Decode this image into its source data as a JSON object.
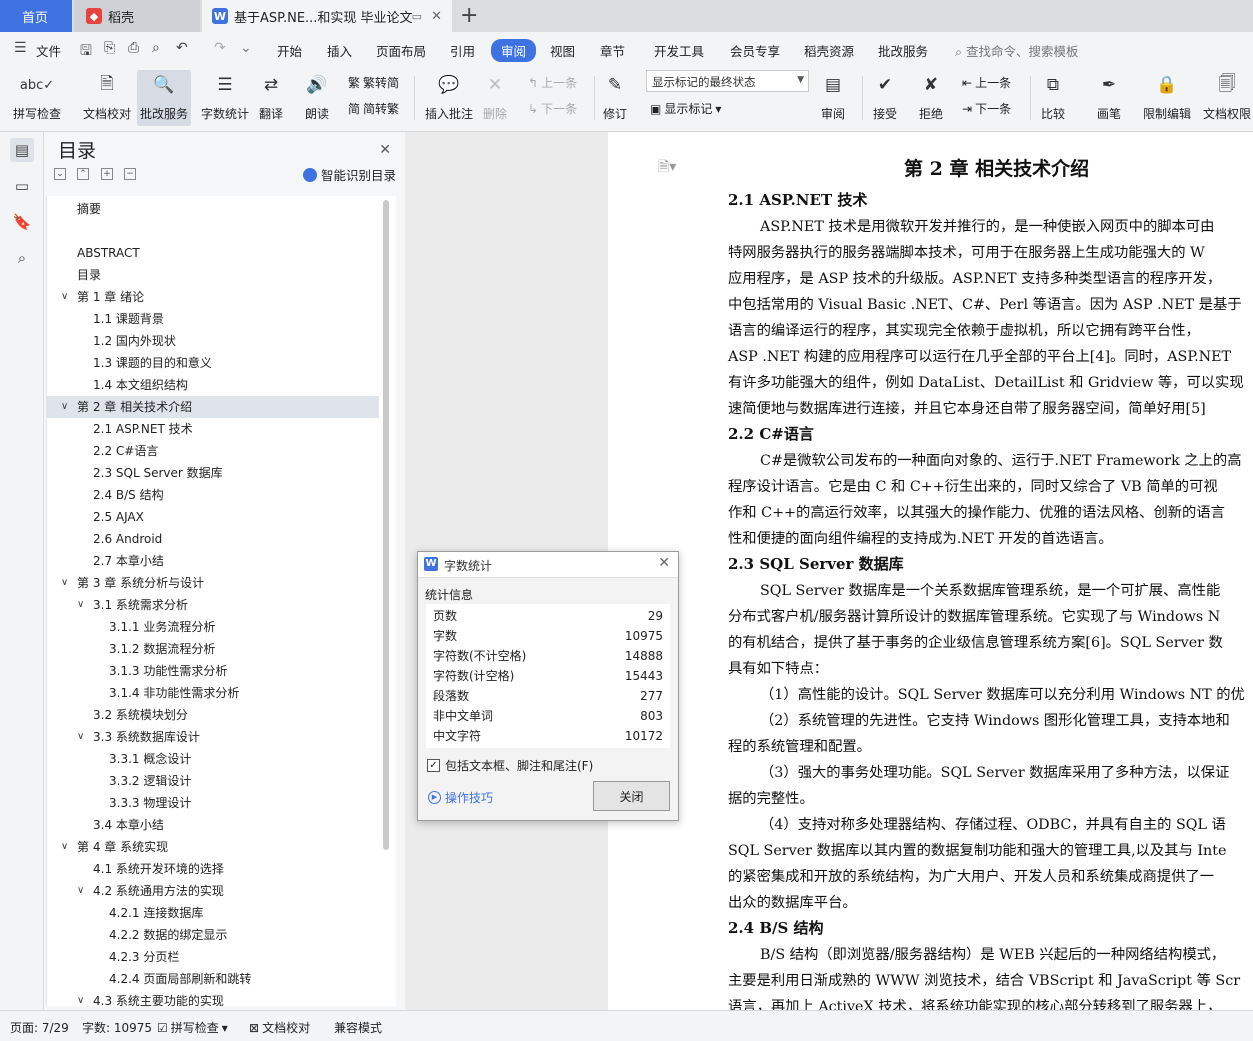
{
  "tabs": {
    "home": "首页",
    "daoke": "稻壳",
    "document": "基于ASP.NE...和实现 毕业论文",
    "new_tab": "+"
  },
  "menu": {
    "file": "文件",
    "items": [
      "开始",
      "插入",
      "页面布局",
      "引用",
      "审阅",
      "视图",
      "章节",
      "开发工具",
      "会员专享",
      "稻壳资源",
      "批改服务"
    ],
    "active": "审阅",
    "search_placeholder": "查找命令、搜索模板"
  },
  "ribbon": {
    "spellcheck": "拼写检查",
    "doc_proof": "文档校对",
    "correction_service": "批改服务",
    "word_count": "字数统计",
    "translate": "翻译",
    "read_aloud": "朗读",
    "trad_to_simp": "繁转简",
    "simp_to_trad": "简转繁",
    "insert_comment": "插入批注",
    "delete": "删除",
    "prev_comment": "上一条",
    "next_comment": "下一条",
    "track_changes": "修订",
    "markup_mode": "显示标记的最终状态",
    "show_markup": "显示标记",
    "review": "审阅",
    "accept": "接受",
    "reject": "拒绝",
    "prev_change": "上一条",
    "next_change": "下一条",
    "compare": "比较",
    "pen": "画笔",
    "restrict_edit": "限制编辑",
    "doc_permission": "文档权限"
  },
  "toc": {
    "title": "目录",
    "smart_toc": "智能识别目录",
    "items": [
      {
        "text": "摘要",
        "level": 0,
        "expand": false
      },
      {
        "text": "ABSTRACT",
        "level": 0,
        "expand": false
      },
      {
        "text": "目录",
        "level": 0,
        "expand": false
      },
      {
        "text": "第 1 章  绪论",
        "level": 0,
        "expand": true
      },
      {
        "text": "1.1  课题背景",
        "level": 1,
        "expand": false
      },
      {
        "text": "1.2  国内外现状",
        "level": 1,
        "expand": false
      },
      {
        "text": "1.3  课题的目的和意义",
        "level": 1,
        "expand": false
      },
      {
        "text": "1.4  本文组织结构",
        "level": 1,
        "expand": false
      },
      {
        "text": "第 2 章  相关技术介绍",
        "level": 0,
        "expand": true,
        "highlight": true
      },
      {
        "text": "2.1 ASP.NET 技术",
        "level": 1,
        "expand": false
      },
      {
        "text": "2.2 C#语言",
        "level": 1,
        "expand": false
      },
      {
        "text": "2.3 SQL Server 数据库",
        "level": 1,
        "expand": false
      },
      {
        "text": "2.4 B/S 结构",
        "level": 1,
        "expand": false
      },
      {
        "text": "2.5 AJAX",
        "level": 1,
        "expand": false
      },
      {
        "text": "2.6 Android",
        "level": 1,
        "expand": false
      },
      {
        "text": "2.7 本章小结",
        "level": 1,
        "expand": false
      },
      {
        "text": "第 3 章  系统分析与设计",
        "level": 0,
        "expand": true
      },
      {
        "text": "3.1  系统需求分析",
        "level": 1,
        "expand": true
      },
      {
        "text": "3.1.1  业务流程分析",
        "level": 2,
        "expand": false
      },
      {
        "text": "3.1.2  数据流程分析",
        "level": 2,
        "expand": false
      },
      {
        "text": "3.1.3  功能性需求分析",
        "level": 2,
        "expand": false
      },
      {
        "text": "3.1.4  非功能性需求分析",
        "level": 2,
        "expand": false
      },
      {
        "text": "3.2  系统模块划分",
        "level": 1,
        "expand": false
      },
      {
        "text": "3.3  系统数据库设计",
        "level": 1,
        "expand": true
      },
      {
        "text": "3.3.1  概念设计",
        "level": 2,
        "expand": false
      },
      {
        "text": "3.3.2  逻辑设计",
        "level": 2,
        "expand": false
      },
      {
        "text": "3.3.3  物理设计",
        "level": 2,
        "expand": false
      },
      {
        "text": "3.4  本章小结",
        "level": 1,
        "expand": false
      },
      {
        "text": "第 4 章  系统实现",
        "level": 0,
        "expand": true
      },
      {
        "text": "4.1  系统开发环境的选择",
        "level": 1,
        "expand": false
      },
      {
        "text": "4.2  系统通用方法的实现",
        "level": 1,
        "expand": true
      },
      {
        "text": "4.2.1  连接数据库",
        "level": 2,
        "expand": false
      },
      {
        "text": "4.2.2  数据的绑定显示",
        "level": 2,
        "expand": false
      },
      {
        "text": "4.2.3  分页栏",
        "level": 2,
        "expand": false
      },
      {
        "text": "4.2.4  页面局部刷新和跳转",
        "level": 2,
        "expand": false
      },
      {
        "text": "4.3  系统主要功能的实现",
        "level": 1,
        "expand": true
      }
    ]
  },
  "document": {
    "lines": [
      {
        "text": "第 2 章  相关技术介绍",
        "style": "h1"
      },
      {
        "text": "2.1 ASP.NET 技术",
        "style": "h2"
      },
      {
        "text": "ASP.NET 技术是用微软开发并推行的，是一种使嵌入网页中的脚本可由",
        "style": "ind"
      },
      {
        "text": "特网服务器执行的服务器端脚本技术，可用于在服务器上生成功能强大的 W",
        "style": "p"
      },
      {
        "text": "应用程序，是 ASP 技术的升级版。ASP.NET 支持多种类型语言的程序开发，",
        "style": "p"
      },
      {
        "text": "中包括常用的 Visual Basic .NET、C#、Perl 等语言。因为 ASP .NET 是基于",
        "style": "p"
      },
      {
        "text": "语言的编译运行的程序，其实现完全依赖于虚拟机，所以它拥有跨平台性，",
        "style": "p"
      },
      {
        "text": "ASP .NET 构建的应用程序可以运行在几乎全部的平台上[4]。同时，ASP.NET",
        "style": "p"
      },
      {
        "text": "有许多功能强大的组件，例如 DataList、DetailList 和 Gridview 等，可以实现",
        "style": "p"
      },
      {
        "text": "速简便地与数据库进行连接，并且它本身还自带了服务器空间，简单好用[5]",
        "style": "p"
      },
      {
        "text": "2.2 C#语言",
        "style": "h2"
      },
      {
        "text": "C#是微软公司发布的一种面向对象的、运行于.NET Framework 之上的高",
        "style": "ind"
      },
      {
        "text": "程序设计语言。它是由 C 和 C++衍生出来的，同时又综合了 VB 简单的可视",
        "style": "p"
      },
      {
        "text": "作和 C++的高运行效率，以其强大的操作能力、优雅的语法风格、创新的语言",
        "style": "p"
      },
      {
        "text": "性和便捷的面向组件编程的支持成为.NET 开发的首选语言。",
        "style": "p"
      },
      {
        "text": "2.3 SQL Server 数据库",
        "style": "h2"
      },
      {
        "text": "SQL Server 数据库是一个关系数据库管理系统，是一个可扩展、高性能",
        "style": "ind"
      },
      {
        "text": "分布式客户机/服务器计算所设计的数据库管理系统。它实现了与 Windows N",
        "style": "p"
      },
      {
        "text": "的有机结合，提供了基于事务的企业级信息管理系统方案[6]。SQL Server 数",
        "style": "p"
      },
      {
        "text": "具有如下特点：",
        "style": "p"
      },
      {
        "text": "（1）高性能的设计。SQL Server 数据库可以充分利用 Windows NT 的优",
        "style": "ind"
      },
      {
        "text": "（2）系统管理的先进性。它支持 Windows 图形化管理工具，支持本地和",
        "style": "ind"
      },
      {
        "text": "程的系统管理和配置。",
        "style": "p"
      },
      {
        "text": "（3）强大的事务处理功能。SQL Server 数据库采用了多种方法，以保证",
        "style": "ind"
      },
      {
        "text": "据的完整性。",
        "style": "p"
      },
      {
        "text": "（4）支持对称多处理器结构、存储过程、ODBC，并具有自主的 SQL 语",
        "style": "ind"
      },
      {
        "text": "SQL Server 数据库以其内置的数据复制功能和强大的管理工具,以及其与 Inte",
        "style": "p"
      },
      {
        "text": "的紧密集成和开放的系统结构，为广大用户、开发人员和系统集成商提供了一",
        "style": "p"
      },
      {
        "text": "出众的数据库平台。",
        "style": "p"
      },
      {
        "text": "2.4 B/S 结构",
        "style": "h2"
      },
      {
        "text": "B/S 结构（即浏览器/服务器结构）是 WEB 兴起后的一种网络结构模式，",
        "style": "ind"
      },
      {
        "text": "主要是利用日渐成熟的 WWW 浏览技术，结合 VBScript 和 JavaScript 等 Scr",
        "style": "p"
      },
      {
        "text": "语言，再加上 ActiveX 技术，将系统功能实现的核心部分转移到了服务器上，",
        "style": "p"
      }
    ]
  },
  "dialog": {
    "title": "字数统计",
    "section": "统计信息",
    "stats": [
      {
        "label": "页数",
        "value": "29"
      },
      {
        "label": "字数",
        "value": "10975"
      },
      {
        "label": "字符数(不计空格)",
        "value": "14888"
      },
      {
        "label": "字符数(计空格)",
        "value": "15443"
      },
      {
        "label": "段落数",
        "value": "277"
      },
      {
        "label": "非中文单词",
        "value": "803"
      },
      {
        "label": "中文字符",
        "value": "10172"
      }
    ],
    "checkbox_label": "包括文本框、脚注和尾注(F)",
    "checkbox_checked": true,
    "tips": "操作技巧",
    "close_button": "关闭"
  },
  "status": {
    "page": "页面: 7/29",
    "words": "字数: 10975",
    "spellcheck": "拼写检查",
    "doc_proof": "文档校对",
    "compat_mode": "兼容模式"
  },
  "colors": {
    "accent": "#3d72e0",
    "wps_red": "#e8423f"
  }
}
